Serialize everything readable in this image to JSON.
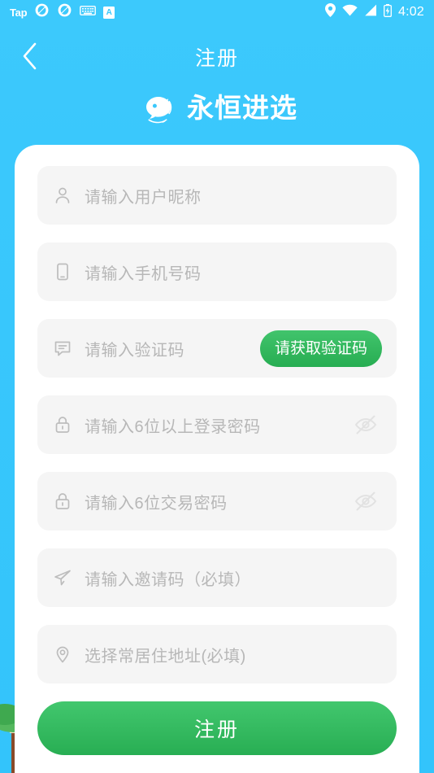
{
  "statusbar": {
    "app_label": "Tap",
    "time": "4:02",
    "icons": [
      "swirl-icon",
      "swirl-icon",
      "keyboard-icon",
      "a-badge-icon",
      "location-pin-icon",
      "wifi-icon",
      "cellular-signal-icon",
      "battery-icon"
    ],
    "a_badge_letter": "A"
  },
  "header": {
    "back_label": "‹",
    "title": "注册",
    "brand_name": "永恒进选"
  },
  "form": {
    "fields": [
      {
        "name": "nickname",
        "icon": "person-icon",
        "placeholder": "请输入用户昵称"
      },
      {
        "name": "phone",
        "icon": "phone-icon",
        "placeholder": "请输入手机号码"
      },
      {
        "name": "verify-code",
        "icon": "message-icon",
        "placeholder": "请输入验证码"
      },
      {
        "name": "login-password",
        "icon": "lock-icon",
        "placeholder": "请输入6位以上登录密码"
      },
      {
        "name": "pay-password",
        "icon": "lock-icon",
        "placeholder": "请输入6位交易密码"
      },
      {
        "name": "invite-code",
        "icon": "paper-plane-icon",
        "placeholder": "请输入邀请码（必填）"
      },
      {
        "name": "address",
        "icon": "location-pin-icon",
        "placeholder": "选择常居住地址(必填)"
      }
    ],
    "get_code_label": "请获取验证码",
    "submit_label": "注册",
    "password_visibility_icon": "eye-off-icon"
  },
  "colors": {
    "background_blue": "#35c6fb",
    "accent_green": "#2eb85c",
    "card_white": "#ffffff",
    "field_gray": "#f5f5f5",
    "placeholder_gray": "#b7b7b7"
  }
}
